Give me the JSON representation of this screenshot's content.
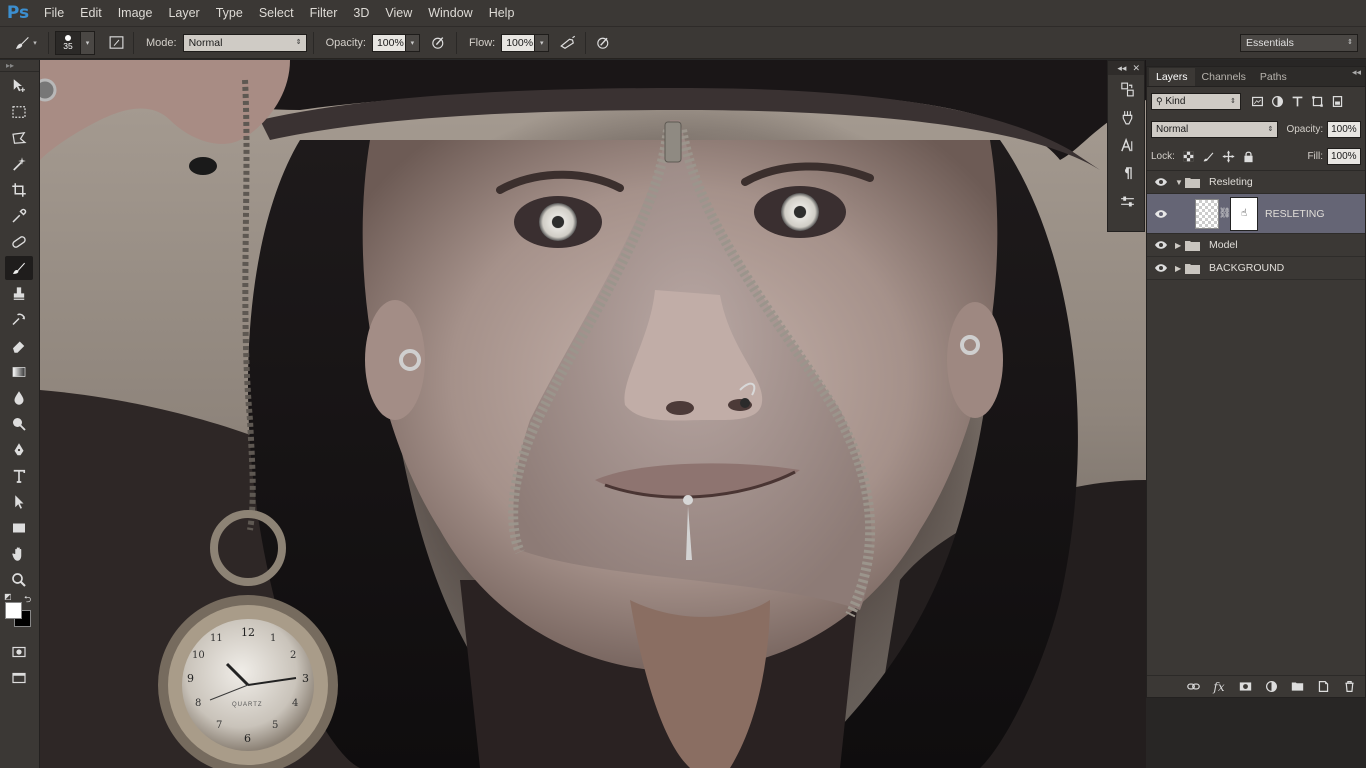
{
  "app": {
    "logo": "Ps",
    "menu": [
      "File",
      "Edit",
      "Image",
      "Layer",
      "Type",
      "Select",
      "Filter",
      "3D",
      "View",
      "Window",
      "Help"
    ]
  },
  "options_bar": {
    "brush_size": "35",
    "mode_label": "Mode:",
    "mode_value": "Normal",
    "opacity_label": "Opacity:",
    "opacity_value": "100%",
    "flow_label": "Flow:",
    "flow_value": "100%",
    "workspace": "Essentials"
  },
  "tools": [
    "move-tool-icon",
    "marquee-tool-icon",
    "lasso-tool-icon",
    "magic-wand-tool-icon",
    "crop-tool-icon",
    "eyedropper-tool-icon",
    "healing-brush-tool-icon",
    "brush-tool-icon",
    "clone-stamp-tool-icon",
    "history-brush-tool-icon",
    "eraser-tool-icon",
    "gradient-tool-icon",
    "blur-tool-icon",
    "dodge-tool-icon",
    "pen-tool-icon",
    "type-tool-icon",
    "path-selection-tool-icon",
    "rectangle-tool-icon",
    "hand-tool-icon",
    "zoom-tool-icon"
  ],
  "active_tool": "brush-tool-icon",
  "colors": {
    "foreground": "#ffffff",
    "background": "#000000",
    "accent_selected_layer": "#656575"
  },
  "canvas": {
    "watch_face_text": "QUARTZ",
    "watch_numbers": [
      "1",
      "2",
      "3",
      "4",
      "5",
      "6",
      "7",
      "8",
      "9",
      "10",
      "11",
      "12"
    ]
  },
  "layers_panel": {
    "tabs": [
      "Layers",
      "Channels",
      "Paths"
    ],
    "active_tab": "Layers",
    "filter_kind": "Kind",
    "blend_mode": "Normal",
    "opacity_label": "Opacity:",
    "opacity_value": "100%",
    "lock_label": "Lock:",
    "fill_label": "Fill:",
    "fill_value": "100%",
    "layers": [
      {
        "name": "Resleting",
        "type": "group",
        "expanded": true
      },
      {
        "name": "RESLETING",
        "type": "layer-with-mask",
        "selected": true
      },
      {
        "name": "Model",
        "type": "group",
        "expanded": false
      },
      {
        "name": "BACKGROUND",
        "type": "group",
        "expanded": false
      }
    ]
  }
}
